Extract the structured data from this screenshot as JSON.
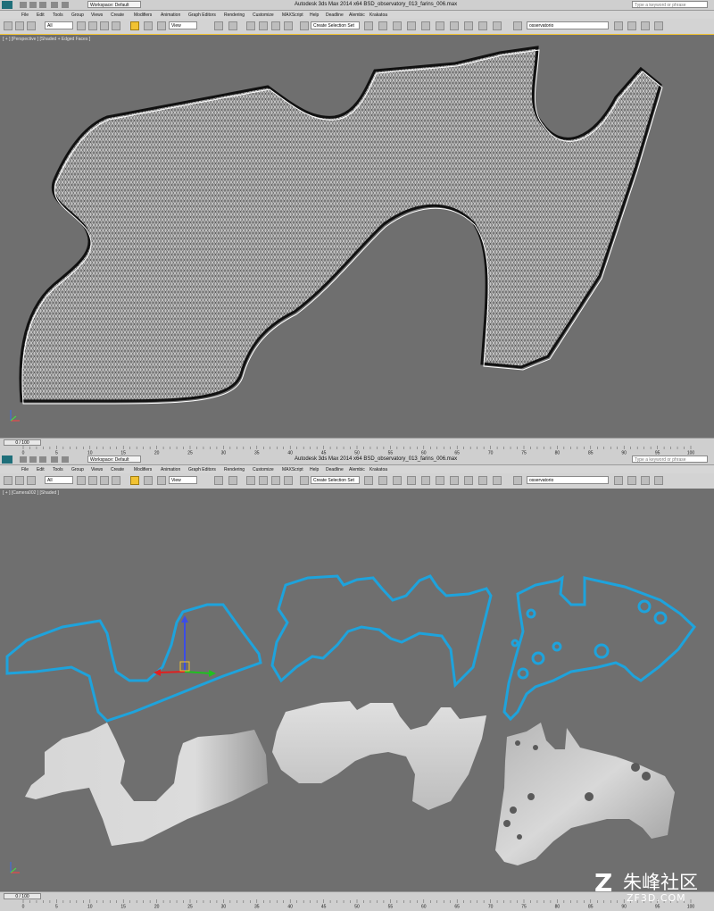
{
  "app": {
    "title": "Autodesk 3ds Max  2014 x64    BSD_observatory_013_farins_006.max",
    "workspace": "Workspace: Default",
    "search_placeholder": "Type a keyword or phrase"
  },
  "menu": [
    "File",
    "Edit",
    "Tools",
    "Group",
    "Views",
    "Create",
    "Modifiers",
    "Animation",
    "Graph Editors",
    "Rendering",
    "Customize",
    "MAXScript",
    "Help",
    "Deadline",
    "Alembic",
    "Krakatoa"
  ],
  "toolbar": {
    "filter": "All",
    "refcoord": "View",
    "selection_set": "Create Selection Set",
    "layer": "osservatorio"
  },
  "viewport_top": {
    "label": "[ + ] [Perspective ] [Shaded + Edged Faces ]"
  },
  "viewport_bottom": {
    "label": "[ + ] [Camera002 ] [Shaded ]"
  },
  "timeline": {
    "frame_display": "0 / 100",
    "ticks": [
      "0",
      "5",
      "10",
      "15",
      "20",
      "25",
      "30",
      "35",
      "40",
      "45",
      "50",
      "55",
      "60",
      "65",
      "70",
      "75",
      "80",
      "85",
      "90",
      "95",
      "100"
    ]
  },
  "watermark": {
    "cn": "朱峰社区",
    "en": "ZF3D.COM",
    "logo": "Z"
  },
  "colors": {
    "spline": "#1ea3dc",
    "viewport_bg": "#6f6f6f",
    "active_tool": "#f1c232"
  }
}
